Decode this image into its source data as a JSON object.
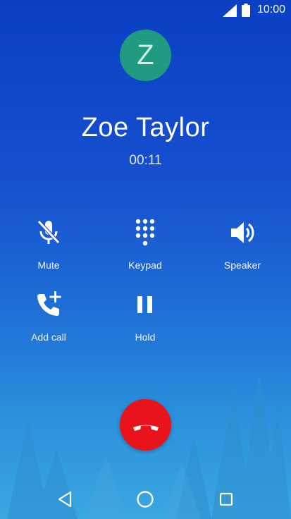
{
  "status_bar": {
    "time": "10:00",
    "icons": [
      "signal-icon",
      "battery-icon"
    ]
  },
  "caller": {
    "initial": "Z",
    "name": "Zoe Taylor",
    "duration": "00:11",
    "avatar_color": "#1f9b82"
  },
  "controls": [
    {
      "label": "Mute",
      "icon": "mic-off-icon"
    },
    {
      "label": "Keypad",
      "icon": "dialpad-icon"
    },
    {
      "label": "Speaker",
      "icon": "speaker-icon"
    },
    {
      "label": "Add call",
      "icon": "add-call-icon"
    },
    {
      "label": "Hold",
      "icon": "pause-icon"
    }
  ],
  "end_call": {
    "icon": "end-call-icon",
    "color": "#e8131b"
  },
  "nav_bar": {
    "icons": [
      "back-icon",
      "home-icon",
      "recents-icon"
    ]
  }
}
